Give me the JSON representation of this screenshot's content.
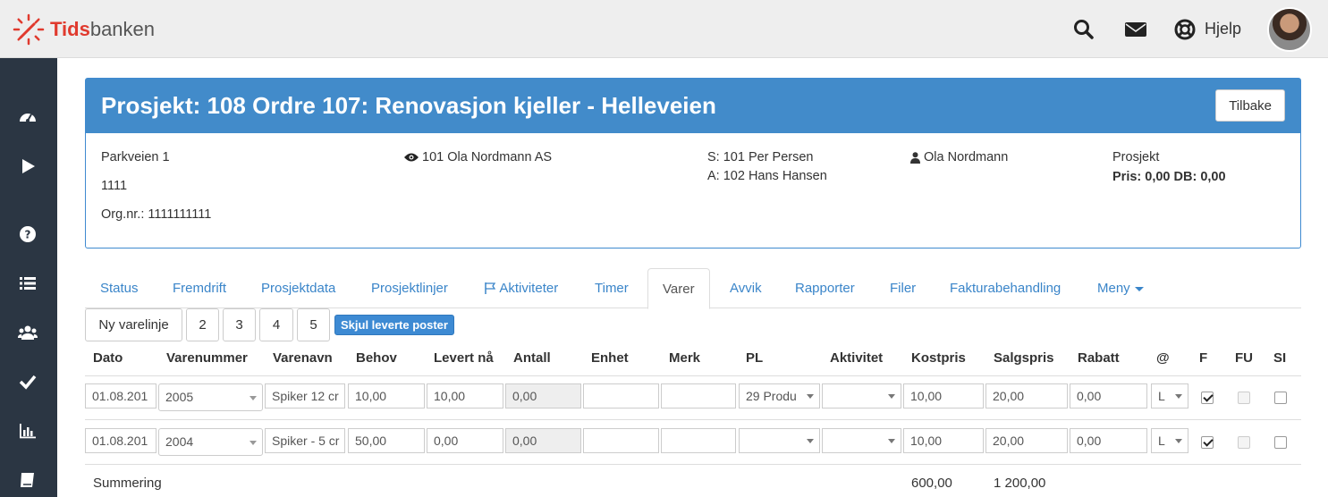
{
  "brand": {
    "name_bold": "Tids",
    "name_rest": "banken"
  },
  "header": {
    "help_label": "Hjelp"
  },
  "project": {
    "title": "Prosjekt: 108 Ordre 107: Renovasjon kjeller - Helleveien",
    "back_label": "Tilbake",
    "address_line1": "Parkveien 1",
    "address_line2": "1111",
    "org_nr": "Org.nr.: 1111111111",
    "customer": "101 Ola Nordmann AS",
    "seller": "S: 101 Per Persen",
    "responsible": "A: 102 Hans Hansen",
    "contact": "Ola Nordmann",
    "type_label": "Prosjekt",
    "price_line": "Pris: 0,00 DB: 0,00"
  },
  "tabs": [
    "Status",
    "Fremdrift",
    "Prosjektdata",
    "Prosjektlinjer",
    "Aktiviteter",
    "Timer",
    "Varer",
    "Avvik",
    "Rapporter",
    "Filer",
    "Fakturabehandling",
    "Meny"
  ],
  "active_tab": "Varer",
  "toolbar": {
    "new_line": "Ny varelinje",
    "pages": [
      "2",
      "3",
      "4",
      "5"
    ],
    "hide_delivered": "Skjul leverte poster"
  },
  "table": {
    "headers": [
      "Dato",
      "Varenummer",
      "Varenavn",
      "Behov",
      "Levert nå",
      "Antall",
      "Enhet",
      "Merk",
      "PL",
      "Aktivitet",
      "Kostpris",
      "Salgspris",
      "Rabatt",
      "@",
      "F",
      "FU",
      "SI"
    ],
    "rows": [
      {
        "dato": "01.08.201",
        "varenummer": "2005",
        "varenavn": "Spiker 12 cr",
        "behov": "10,00",
        "levert": "10,00",
        "antall": "0,00",
        "enhet": "",
        "merk": "",
        "pl": "29 Produ",
        "aktivitet": "",
        "kostpris": "10,00",
        "salgspris": "20,00",
        "rabatt": "0,00",
        "at": "L",
        "f": true,
        "fu": false,
        "si": false
      },
      {
        "dato": "01.08.201",
        "varenummer": "2004",
        "varenavn": "Spiker - 5 cr",
        "behov": "50,00",
        "levert": "0,00",
        "antall": "0,00",
        "enhet": "",
        "merk": "",
        "pl": "",
        "aktivitet": "",
        "kostpris": "10,00",
        "salgspris": "20,00",
        "rabatt": "0,00",
        "at": "L",
        "f": true,
        "fu": false,
        "si": false
      }
    ],
    "summary": {
      "label": "Summering",
      "kostpris": "600,00",
      "salgspris": "1 200,00"
    }
  },
  "colors": {
    "primary": "#428bca",
    "sidebar": "#2b3643",
    "link": "#3a85c9",
    "brand_red": "#e03a2e"
  }
}
